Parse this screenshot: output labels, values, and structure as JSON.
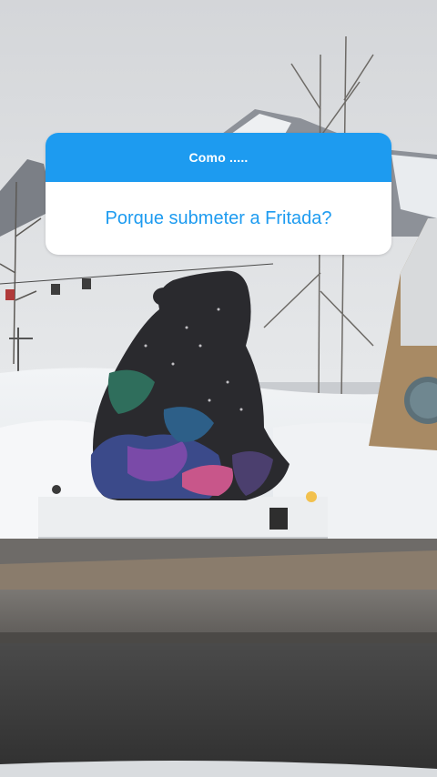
{
  "question_sticker": {
    "header": "Como .....",
    "answer": "Porque submeter a Fritada?",
    "header_color": "#1d9bf0",
    "answer_color": "#1d9bf0"
  },
  "photo": {
    "subject": "bear-sculpture-icon"
  }
}
